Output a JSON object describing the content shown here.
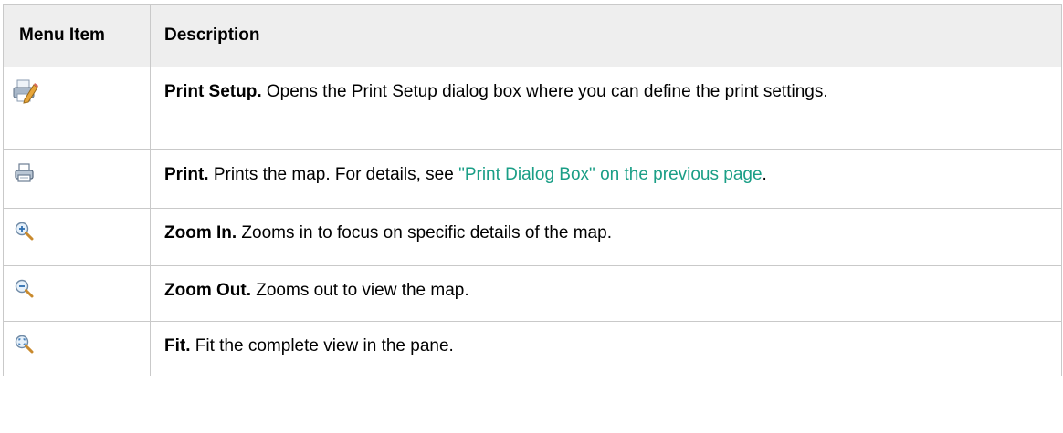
{
  "table": {
    "headers": [
      "Menu Item",
      "Description"
    ],
    "rows": [
      {
        "icon": "print-setup-icon",
        "term": "Print Setup.",
        "text": " Opens the Print Setup dialog box where you can define the print settings."
      },
      {
        "icon": "print-icon",
        "term": "Print.",
        "text": " Prints the map. For details, see ",
        "link": "\"Print Dialog Box\" on the previous page",
        "text_after": "."
      },
      {
        "icon": "zoom-in-icon",
        "term": "Zoom In.",
        "text": " Zooms in to focus on specific details of the map."
      },
      {
        "icon": "zoom-out-icon",
        "term": "Zoom Out.",
        "text": " Zooms out to view the map."
      },
      {
        "icon": "fit-icon",
        "term": "Fit.",
        "text": " Fit the complete view in the pane."
      }
    ]
  },
  "colors": {
    "link": "#1a9e86",
    "header_background": "#eeeeee",
    "border": "#c9c9c9"
  }
}
